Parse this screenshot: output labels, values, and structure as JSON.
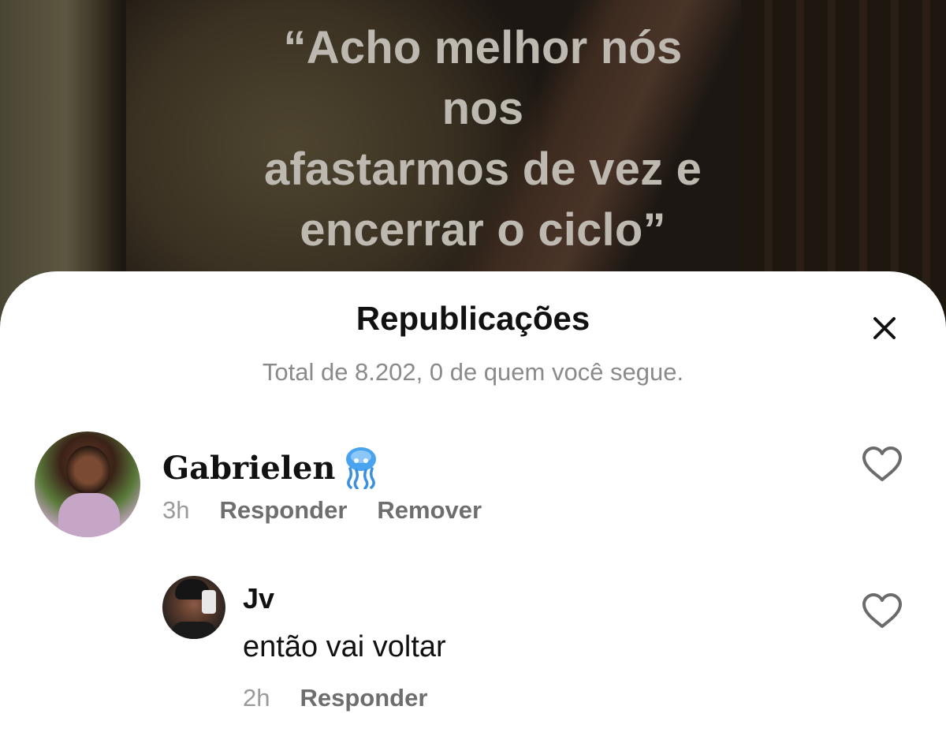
{
  "video": {
    "caption_lines": [
      "“Acho melhor nós nos",
      "afastarmos de vez e",
      "encerrar o ciclo”"
    ]
  },
  "sheet": {
    "title": "Republicações",
    "subtitle": "Total de 8.202, 0 de quem você segue.",
    "close_icon": "close-icon"
  },
  "comment": {
    "username": "Gabrielen",
    "emoji": "jellyfish-emoji",
    "time": "3h",
    "reply_label": "Responder",
    "remove_label": "Remover",
    "like_icon": "heart-outline-icon"
  },
  "reply": {
    "username": "Jv",
    "text": "então vai voltar",
    "time": "2h",
    "reply_label": "Responder",
    "like_icon": "heart-outline-icon"
  },
  "colors": {
    "caption": "#bdb8b0",
    "subtitle": "#8a8a8a",
    "meta_link": "#6e6e6e",
    "heart": "#6b6b6b",
    "jellyfish": "#3a8fe0"
  }
}
